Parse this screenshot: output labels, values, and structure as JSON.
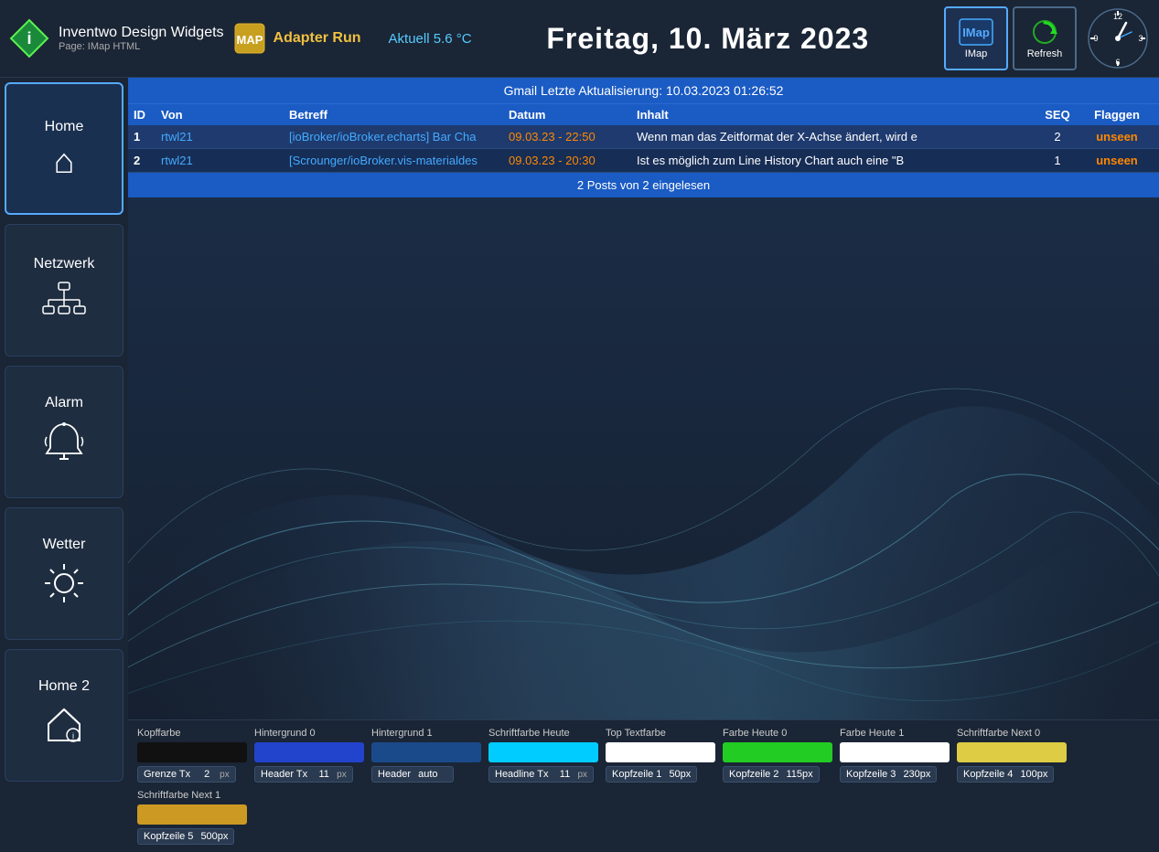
{
  "app": {
    "title": "Inventwo Design Widgets",
    "subtitle": "Page: IMap HTML"
  },
  "adapter": {
    "label": "Adapter Run"
  },
  "temperature": {
    "value": "Aktuell 5.6 °C"
  },
  "date": {
    "value": "Freitag, 10. März 2023"
  },
  "imap_button": {
    "label": "IMap"
  },
  "refresh_button": {
    "label": "Refresh"
  },
  "sidebar": {
    "items": [
      {
        "id": "home",
        "label": "Home",
        "active": true
      },
      {
        "id": "netzwerk",
        "label": "Netzwerk",
        "active": false
      },
      {
        "id": "alarm",
        "label": "Alarm",
        "active": false
      },
      {
        "id": "wetter",
        "label": "Wetter",
        "active": false
      },
      {
        "id": "home2",
        "label": "Home 2",
        "active": false
      }
    ]
  },
  "email_table": {
    "header": "Gmail   Letzte Aktualisierung: 10.03.2023 01:26:52",
    "columns": [
      "ID",
      "Von",
      "Betreff",
      "Datum",
      "Inhalt",
      "SEQ",
      "Flaggen"
    ],
    "rows": [
      {
        "id": "1",
        "von": "rtwl21",
        "betreff": "[ioBroker/ioBroker.echarts] Bar Cha",
        "datum": "09.03.23 - 22:50",
        "inhalt": "Wenn man das Zeitformat der X-Achse ändert, wird e",
        "seq": "2",
        "flaggen": "unseen"
      },
      {
        "id": "2",
        "von": "rtwl21",
        "betreff": "[Scrounger/ioBroker.vis-materialdes",
        "datum": "09.03.23 - 20:30",
        "inhalt": "Ist es möglich zum Line History Chart auch eine \"B",
        "seq": "1",
        "flaggen": "unseen"
      }
    ],
    "footer": "2 Posts von 2 eingelesen"
  },
  "settings": [
    {
      "id": "kopffarbe",
      "label": "Kopffarbe",
      "color": "#111111",
      "input_label": "Grenze Tx",
      "input_val": "2",
      "input_unit": "px"
    },
    {
      "id": "hintergrund0",
      "label": "Hintergrund 0",
      "color": "#2244cc",
      "input_label": "Header Tx",
      "input_val": "11",
      "input_unit": "px"
    },
    {
      "id": "hintergrund1",
      "label": "Hintergrund 1",
      "color": "#1a4a8a",
      "input_label": "Header",
      "input_val": "auto",
      "input_unit": ""
    },
    {
      "id": "schriftfarbe_heute",
      "label": "Schriftfarbe Heute",
      "color": "#00ccff",
      "input_label": "Headline Tx",
      "input_val": "11",
      "input_unit": "px"
    },
    {
      "id": "top_textfarbe",
      "label": "Top Textfarbe",
      "color": "#ffffff",
      "input_label": "Kopfzeile 1",
      "input_val": "50px",
      "input_unit": ""
    },
    {
      "id": "farbe_heute0",
      "label": "Farbe Heute 0",
      "color": "#22cc22",
      "input_label": "Kopfzeile 2",
      "input_val": "115px",
      "input_unit": ""
    },
    {
      "id": "farbe_heute1",
      "label": "Farbe Heute 1",
      "color": "#ffffff",
      "input_label": "Kopfzeile 3",
      "input_val": "230px",
      "input_unit": ""
    },
    {
      "id": "schriftfarbe_next0",
      "label": "Schriftfarbe Next 0",
      "color": "#ddcc44",
      "input_label": "Kopfzeile 4",
      "input_val": "100px",
      "input_unit": ""
    },
    {
      "id": "schriftfarbe_next1",
      "label": "Schriftfarbe Next 1",
      "color": "#cc9922",
      "input_label": "Kopfzeile 5",
      "input_val": "500px",
      "input_unit": ""
    }
  ]
}
